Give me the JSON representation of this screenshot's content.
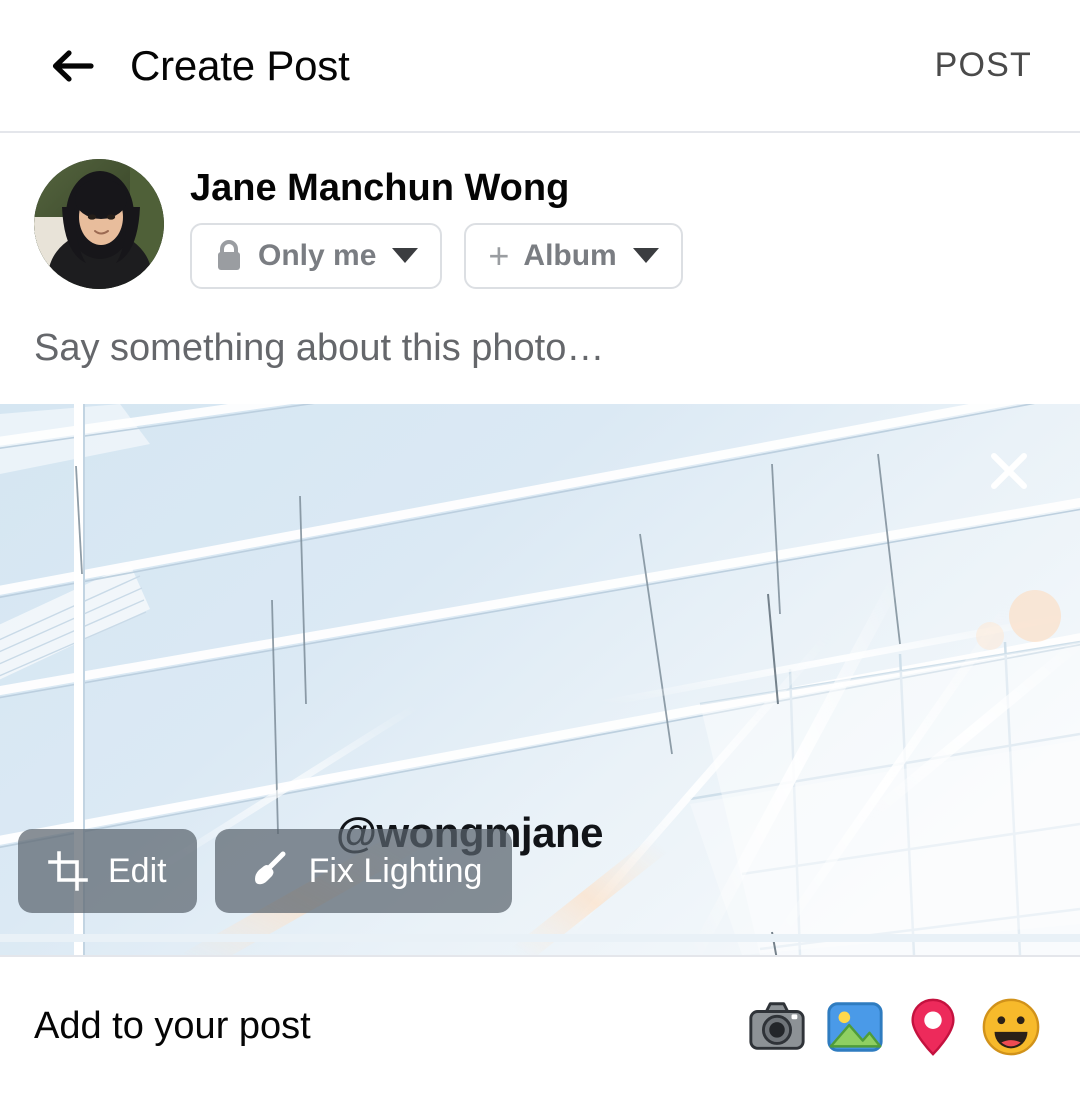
{
  "header": {
    "back_icon": "back-arrow-icon",
    "title": "Create Post",
    "post_label": "POST"
  },
  "composer": {
    "avatar_alt": "avatar",
    "user_name": "Jane Manchun Wong",
    "privacy": {
      "icon": "lock-icon",
      "label": "Only me",
      "caret": "chevron-down-icon"
    },
    "album": {
      "icon": "plus-icon",
      "plus": "+",
      "label": "Album",
      "caret": "chevron-down-icon"
    },
    "status_placeholder": "Say something about this photo…"
  },
  "photo": {
    "close_icon": "close-icon",
    "watermark": "@wongmjane",
    "actions": [
      {
        "icon": "crop-icon",
        "label": "Edit"
      },
      {
        "icon": "brush-icon",
        "label": "Fix Lighting"
      }
    ]
  },
  "bottom": {
    "label": "Add to your post",
    "items": [
      {
        "icon": "camera-icon",
        "name": "camera"
      },
      {
        "icon": "photo-icon",
        "name": "photo"
      },
      {
        "icon": "location-pin-icon",
        "name": "location"
      },
      {
        "icon": "smiley-face-icon",
        "name": "feeling"
      }
    ]
  },
  "colors": {
    "text_primary": "#050505",
    "text_secondary": "#65676b",
    "pill_border": "#dcdfe3",
    "divider": "#e4e6eb",
    "photo_sky": "#d7e6f2",
    "overlay_button": "rgba(90,100,110,0.72)",
    "location_pin": "#ed2a5b",
    "smiley": "#f7ba2b",
    "photo_icon_blue": "#4a9ae8",
    "camera_gray": "#6f7479"
  }
}
